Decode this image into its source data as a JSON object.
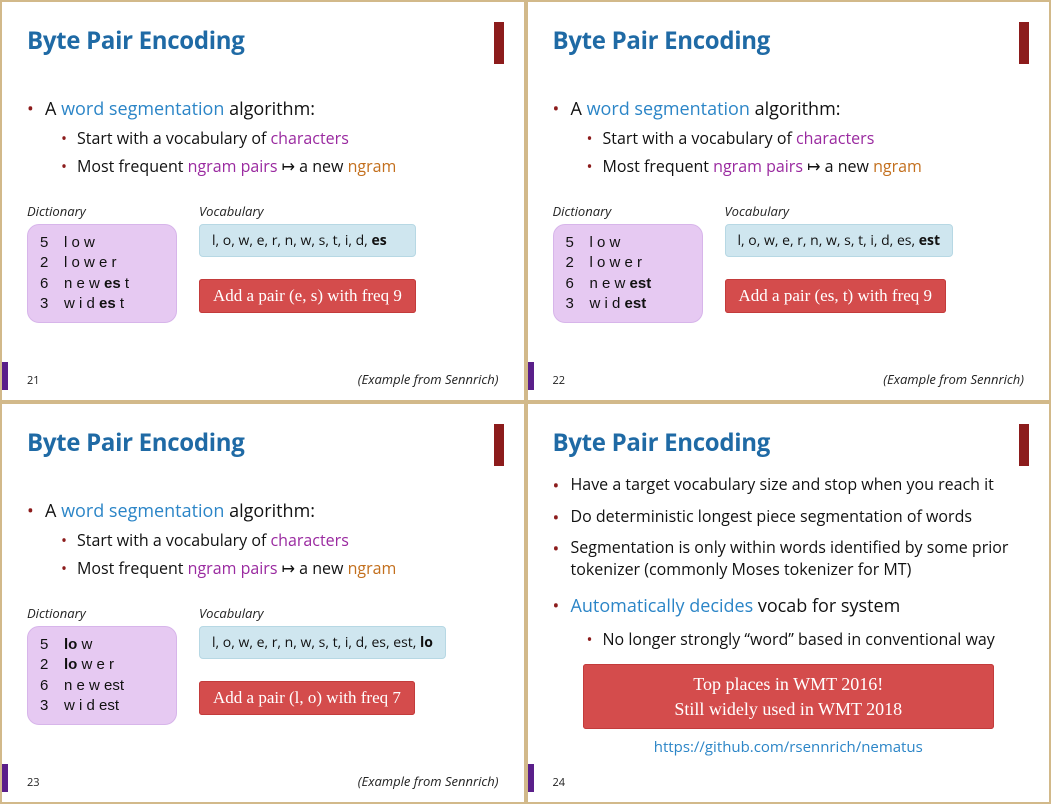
{
  "slides": [
    {
      "num": "21",
      "title": "Byte Pair Encoding",
      "lead_pre": "A ",
      "lead_hl": "word segmentation",
      "lead_post": " algorithm:",
      "sub1_pre": "Start with a vocabulary of ",
      "sub1_hl": "characters",
      "sub2_pre": "Most frequent ",
      "sub2_hl1": "ngram pairs",
      "sub2_mid": " ↦ a new ",
      "sub2_hl2": "ngram",
      "dict_label": "Dictionary",
      "dict_rows": [
        {
          "cnt": "5",
          "pre": "l o w",
          "bold": "",
          "post": ""
        },
        {
          "cnt": "2",
          "pre": "l o w e r",
          "bold": "",
          "post": ""
        },
        {
          "cnt": "6",
          "pre": "n e w ",
          "bold": "es",
          "post": " t"
        },
        {
          "cnt": "3",
          "pre": "w i d ",
          "bold": "es",
          "post": " t"
        }
      ],
      "vocab_label": "Vocabulary",
      "vocab_pre": "l, o, w, e, r, n, w, s, t, i, d, ",
      "vocab_bold": "es",
      "note": "Add a pair (e, s) with freq 9",
      "credit": "(Example from Sennrich)"
    },
    {
      "num": "22",
      "title": "Byte Pair Encoding",
      "lead_pre": "A ",
      "lead_hl": "word segmentation",
      "lead_post": " algorithm:",
      "sub1_pre": "Start with a vocabulary of ",
      "sub1_hl": "characters",
      "sub2_pre": "Most frequent ",
      "sub2_hl1": "ngram pairs",
      "sub2_mid": " ↦ a new ",
      "sub2_hl2": "ngram",
      "dict_label": "Dictionary",
      "dict_rows": [
        {
          "cnt": "5",
          "pre": "l o w",
          "bold": "",
          "post": ""
        },
        {
          "cnt": "2",
          "pre": "l o w e r",
          "bold": "",
          "post": ""
        },
        {
          "cnt": "6",
          "pre": "n e w ",
          "bold": "est",
          "post": ""
        },
        {
          "cnt": "3",
          "pre": "w i d ",
          "bold": "est",
          "post": ""
        }
      ],
      "vocab_label": "Vocabulary",
      "vocab_pre": "l, o, w, e, r, n, w, s, t, i, d, es, ",
      "vocab_bold": "est",
      "note": "Add a pair (es, t) with freq 9",
      "credit": "(Example from Sennrich)"
    },
    {
      "num": "23",
      "title": "Byte Pair Encoding",
      "lead_pre": "A ",
      "lead_hl": "word segmentation",
      "lead_post": " algorithm:",
      "sub1_pre": "Start with a vocabulary of ",
      "sub1_hl": "characters",
      "sub2_pre": "Most frequent ",
      "sub2_hl1": "ngram pairs",
      "sub2_mid": " ↦ a new ",
      "sub2_hl2": "ngram",
      "dict_label": "Dictionary",
      "dict_rows": [
        {
          "cnt": "5",
          "pre": "",
          "bold": "lo",
          "post": " w"
        },
        {
          "cnt": "2",
          "pre": "",
          "bold": "lo",
          "post": " w e r"
        },
        {
          "cnt": "6",
          "pre": "n e w est",
          "bold": "",
          "post": ""
        },
        {
          "cnt": "3",
          "pre": "w i d est",
          "bold": "",
          "post": ""
        }
      ],
      "vocab_label": "Vocabulary",
      "vocab_pre": "l, o, w, e, r, n, w, s, t, i, d, es, est, ",
      "vocab_bold": "lo",
      "note": "Add a pair (l, o) with freq 7",
      "credit": "(Example from Sennrich)"
    },
    {
      "num": "24",
      "title": "Byte Pair Encoding",
      "bullets": [
        "Have a target vocabulary size and stop when you reach it",
        "Do deterministic longest piece segmentation of words",
        "Segmentation is only within words identified by some prior tokenizer (commonly Moses tokenizer for MT)"
      ],
      "auto_hl": "Automatically decides",
      "auto_rest": " vocab for system",
      "auto_sub": "No longer strongly “word” based in conventional way",
      "wmt_l1": "Top places in WMT 2016!",
      "wmt_l2": "Still widely used in WMT 2018",
      "link": "https://github.com/rsennrich/nematus"
    }
  ]
}
